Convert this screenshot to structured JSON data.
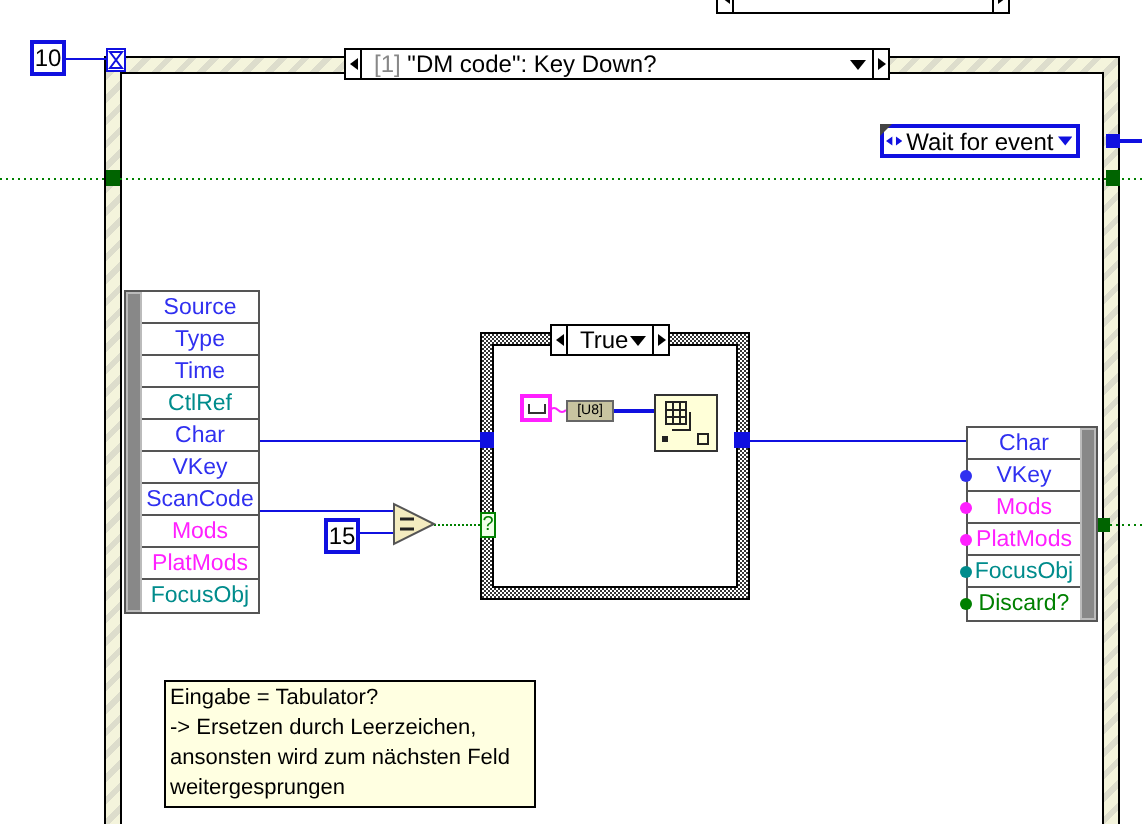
{
  "timeout_constant": "10",
  "event_structure": {
    "case_index": "[1]",
    "case_label": "\"DM code\": Key Down?"
  },
  "state_enum": {
    "label": "Wait for event"
  },
  "event_data_node": {
    "items": [
      {
        "label": "Source",
        "color": "#3030f0"
      },
      {
        "label": "Type",
        "color": "#3030f0"
      },
      {
        "label": "Time",
        "color": "#3030f0"
      },
      {
        "label": "CtlRef",
        "color": "#008c8c"
      },
      {
        "label": "Char",
        "color": "#3030f0"
      },
      {
        "label": "VKey",
        "color": "#3030f0"
      },
      {
        "label": "ScanCode",
        "color": "#3030f0"
      },
      {
        "label": "Mods",
        "color": "#ff20ff"
      },
      {
        "label": "PlatMods",
        "color": "#ff20ff"
      },
      {
        "label": "FocusObj",
        "color": "#008c8c"
      }
    ]
  },
  "comparison_constant": "15",
  "case_structure": {
    "selector": "True",
    "selector_terminal": "?",
    "conversion_label": "[U8]"
  },
  "event_filter_node": {
    "items": [
      {
        "label": "Char",
        "color": "#3030f0",
        "wired": true
      },
      {
        "label": "VKey",
        "color": "#3030f0",
        "wired": false
      },
      {
        "label": "Mods",
        "color": "#ff20ff",
        "wired": false
      },
      {
        "label": "PlatMods",
        "color": "#ff20ff",
        "wired": false
      },
      {
        "label": "FocusObj",
        "color": "#008c8c",
        "wired": false
      },
      {
        "label": "Discard?",
        "color": "#008000",
        "wired": false
      }
    ]
  },
  "comment": "Eingabe = Tabulator?\n-> Ersetzen durch Leerzeichen,\nansonsten wird zum nächsten Feld\nweitergesprungen"
}
